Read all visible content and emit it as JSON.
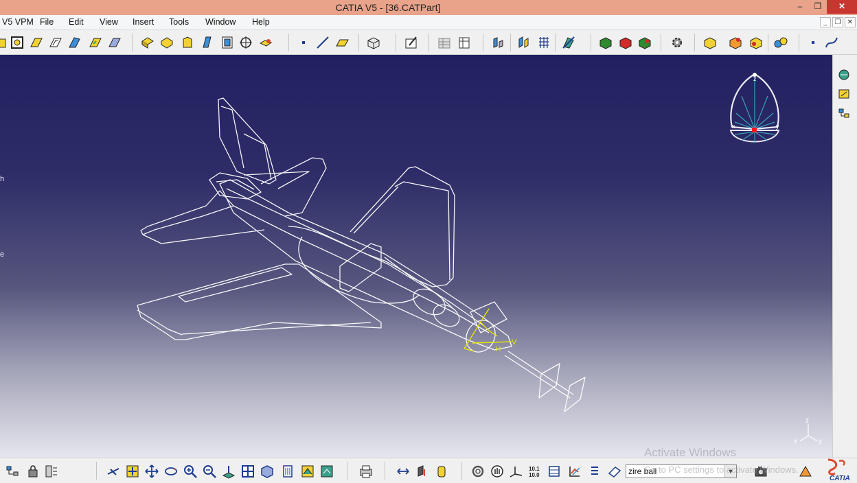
{
  "window": {
    "title": "CATIA V5 - [36.CATPart]",
    "minimize": "–",
    "restore": "❐",
    "close": "✕"
  },
  "menu": {
    "items": [
      {
        "label": "V5 VPM"
      },
      {
        "label": "File"
      },
      {
        "label": "Edit"
      },
      {
        "label": "View"
      },
      {
        "label": "Insert"
      },
      {
        "label": "Tools"
      },
      {
        "label": "Window"
      },
      {
        "label": "Help"
      }
    ],
    "mdi": {
      "minimize": "_",
      "restore": "❐",
      "close": "✕"
    }
  },
  "viewport": {
    "compass_labels": {
      "z": "z",
      "x": "x",
      "y": "y"
    },
    "axis_labels": {
      "z": "z",
      "x": "x",
      "y": "y"
    },
    "sketch_labels": {
      "h": "H",
      "v": "V"
    },
    "edge_labels": [
      "h",
      "e"
    ]
  },
  "bottom": {
    "command_input": {
      "value": "zire ball",
      "placeholder": ""
    },
    "watermark": {
      "line1": "Activate Windows",
      "line2": "Go to PC settings to activate Windows."
    },
    "logo_text": "CATIA"
  },
  "colors": {
    "accent": "#d94a2e",
    "titlebar": "#e8a38a",
    "wireframe": "#ffffff",
    "highlight": "#e6e600"
  }
}
